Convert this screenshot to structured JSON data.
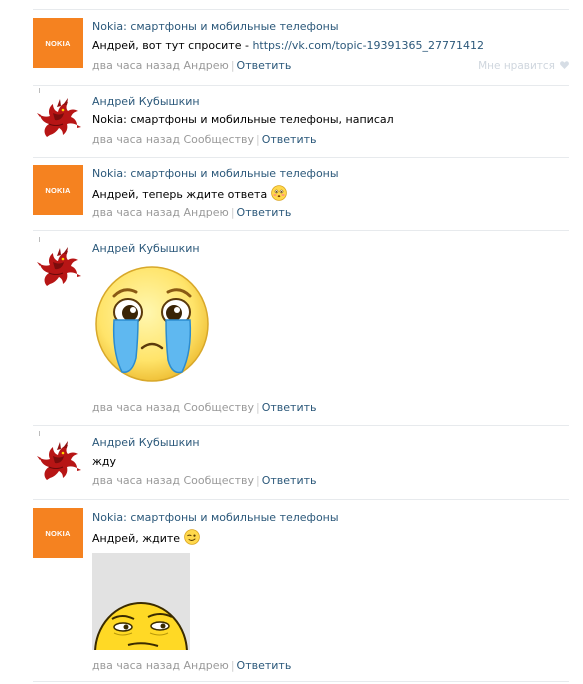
{
  "comments": [
    {
      "author": "Nokia: смартфоны и мобильные телефоны",
      "text_prefix": "Андрей, вот тут спросите - ",
      "link": "https://vk.com/topic-19391365_27771412",
      "time": "два часа назад",
      "reply_to": "Андрею",
      "reply_label": "Ответить",
      "like_label": "Мне нравится",
      "avatar_text": "NOKIA"
    },
    {
      "author": "Андрей Кубышкин",
      "text": "Nokia: смартфоны и мобильные телефоны, написал",
      "time": "два часа назад",
      "reply_to": "Сообществу",
      "reply_label": "Ответить"
    },
    {
      "author": "Nokia: смартфоны и мобильные телефоны",
      "text": "Андрей, теперь ждите ответа",
      "time": "два часа назад",
      "reply_to": "Андрею",
      "reply_label": "Ответить",
      "avatar_text": "NOKIA"
    },
    {
      "author": "Андрей Кубышкин",
      "time": "два часа назад",
      "reply_to": "Сообществу",
      "reply_label": "Ответить"
    },
    {
      "author": "Андрей Кубышкин",
      "text": "жду",
      "time": "два часа назад",
      "reply_to": "Сообществу",
      "reply_label": "Ответить"
    },
    {
      "author": "Nokia: смартфоны и мобильные телефоны",
      "text": "Андрей, ждите",
      "time": "два часа назад",
      "reply_to": "Андрею",
      "reply_label": "Ответить",
      "avatar_text": "NOKIA"
    }
  ],
  "icons": {
    "plus": "plus-icon",
    "heart": "heart-icon",
    "emoji_blush": "blushing-emoji-icon",
    "emoji_wink": "winking-emoji-icon",
    "sticker_cry": "crying-emoji-sticker",
    "sticker_smirk": "smirking-face-sticker",
    "avatar_dragon": "red-dragon-avatar"
  },
  "colors": {
    "link": "#2b587a",
    "meta": "#999999",
    "nokia": "#f58220",
    "separator": "#e7eaed"
  }
}
